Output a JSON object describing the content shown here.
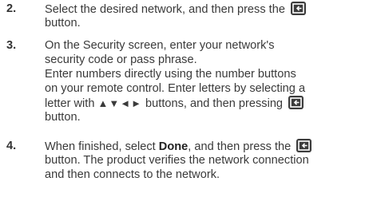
{
  "steps": [
    {
      "number": "2.",
      "l1": "Select the desired network, and then press the",
      "l2": "button."
    },
    {
      "number": "3.",
      "l1": "On the Security screen, enter your network's",
      "l2": "security code or pass phrase.",
      "l3": "Enter numbers directly using the number buttons",
      "l4": "on your remote control. Enter letters by selecting a",
      "l5a": "letter with",
      "arrows": "▲▼◄►",
      "l5b": "buttons, and then pressing",
      "l6": "button."
    },
    {
      "number": "4.",
      "l1a": "When finished, select",
      "done": "Done",
      "l1b": ", and then press the",
      "l2": "button. The product verifies the network connection",
      "l3": "and then connects to the network."
    }
  ],
  "icons": {
    "enter": "enter-button-icon"
  },
  "colors": {
    "text": "#3a3a3a",
    "icon_bg": "#3c3c3c"
  }
}
